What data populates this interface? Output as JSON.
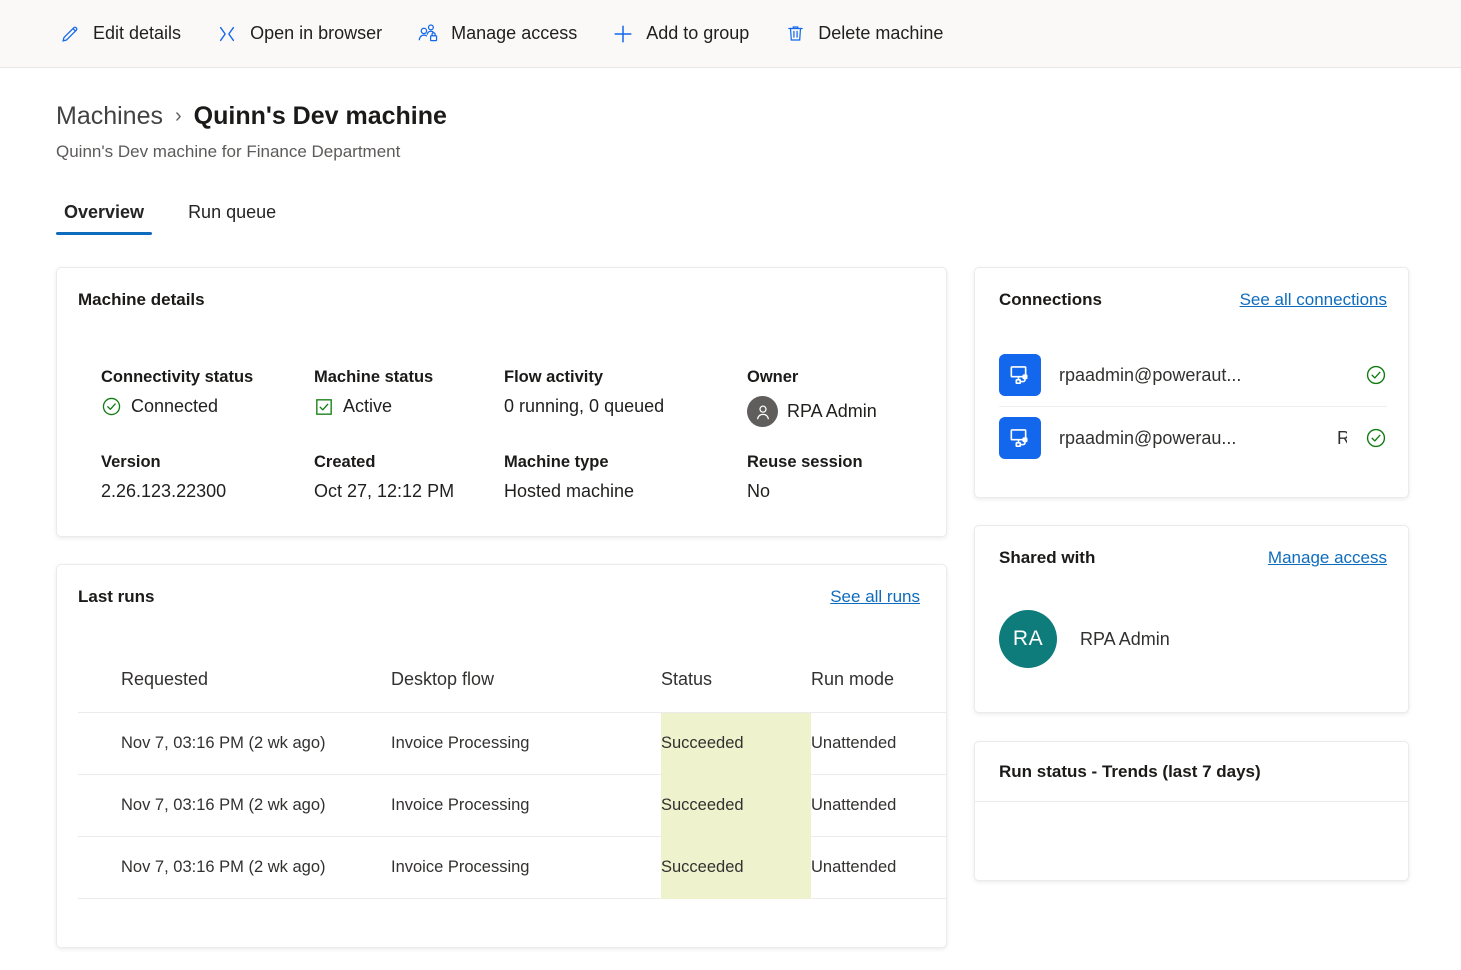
{
  "commandbar": {
    "items": [
      {
        "label": "Edit details",
        "icon": "pencil-icon"
      },
      {
        "label": "Open in browser",
        "icon": "open-in-browser-icon"
      },
      {
        "label": "Manage access",
        "icon": "manage-access-icon"
      },
      {
        "label": "Add to group",
        "icon": "plus-icon"
      },
      {
        "label": "Delete machine",
        "icon": "trash-icon"
      }
    ]
  },
  "header": {
    "breadcrumb_parent": "Machines",
    "breadcrumb_separator": "›",
    "title": "Quinn's Dev machine",
    "subtitle": "Quinn's Dev machine for Finance Department"
  },
  "tabs": [
    {
      "label": "Overview",
      "active": true
    },
    {
      "label": "Run queue",
      "active": false
    }
  ],
  "machine_details": {
    "title": "Machine details",
    "fields": [
      {
        "label": "Connectivity status",
        "value": "Connected",
        "icon": "check-circle-icon"
      },
      {
        "label": "Machine status",
        "value": "Active",
        "icon": "check-box-icon"
      },
      {
        "label": "Flow activity",
        "value": "0 running, 0 queued",
        "icon": "none"
      },
      {
        "label": "Owner",
        "value": "RPA Admin",
        "icon": "person-avatar-icon"
      },
      {
        "label": "Version",
        "value": "2.26.123.22300",
        "icon": "none"
      },
      {
        "label": "Created",
        "value": "Oct 27, 12:12 PM",
        "icon": "none"
      },
      {
        "label": "Machine type",
        "value": "Hosted machine",
        "icon": "none"
      },
      {
        "label": "Reuse session",
        "value": "No",
        "icon": "none"
      }
    ]
  },
  "last_runs": {
    "title": "Last runs",
    "link": "See all runs",
    "columns": [
      "Requested",
      "Desktop flow",
      "Status",
      "Run mode"
    ],
    "rows": [
      {
        "requested": "Nov 7, 03:16 PM (2 wk ago)",
        "desktop_flow": "Invoice Processing",
        "status": "Succeeded",
        "run_mode": "Unattended"
      },
      {
        "requested": "Nov 7, 03:16 PM (2 wk ago)",
        "desktop_flow": "Invoice Processing",
        "status": "Succeeded",
        "run_mode": "Unattended"
      },
      {
        "requested": "Nov 7, 03:16 PM (2 wk ago)",
        "desktop_flow": "Invoice Processing",
        "status": "Succeeded",
        "run_mode": "Unattended"
      }
    ]
  },
  "connections": {
    "title": "Connections",
    "link": "See all connections",
    "items": [
      {
        "name": "rpaadmin@poweraut...",
        "extra": "",
        "status_icon": "check-circle-icon"
      },
      {
        "name": "rpaadmin@powerau...",
        "extra": "R",
        "status_icon": "check-circle-icon"
      }
    ]
  },
  "shared_with": {
    "title": "Shared with",
    "link": "Manage access",
    "people": [
      {
        "initials": "RA",
        "name": "RPA Admin"
      }
    ]
  },
  "run_status_trends": {
    "title": "Run status - Trends (last 7 days)"
  },
  "colors": {
    "accent": "#0f6cbd",
    "command_icon": "#1267ec",
    "success_green": "#107c10",
    "status_highlight": "#eef2cd",
    "avatar_teal": "#0e7c7b",
    "connection_tile": "#1267ec"
  }
}
